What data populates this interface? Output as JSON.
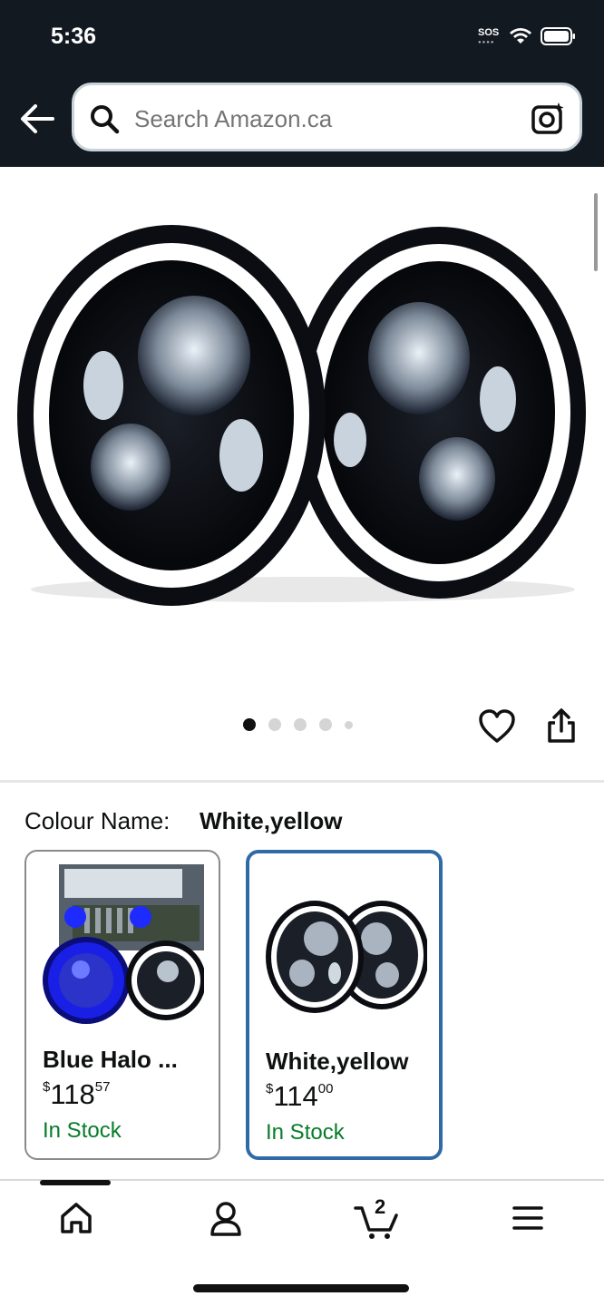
{
  "status_bar": {
    "time": "5:36",
    "sos": "SOS"
  },
  "search": {
    "placeholder": "Search Amazon.ca"
  },
  "carousel": {
    "total_images": 5,
    "active_index": 0
  },
  "variation": {
    "label": "Colour Name:",
    "selected": "White,yellow",
    "options": [
      {
        "name": "Blue Halo ...",
        "price_symbol": "$",
        "price_whole": "118",
        "price_fraction": "57",
        "stock": "In Stock",
        "selected": false
      },
      {
        "name": "White,yellow",
        "price_symbol": "$",
        "price_whole": "114",
        "price_fraction": "00",
        "stock": "In Stock",
        "selected": true
      }
    ]
  },
  "bottom_nav": {
    "items": [
      "home-icon",
      "account-icon",
      "cart-icon",
      "menu-icon"
    ],
    "cart_count": "2"
  },
  "colors": {
    "header": "#131921",
    "in_stock": "#067d2a",
    "selected_border": "#2f6aa5"
  }
}
